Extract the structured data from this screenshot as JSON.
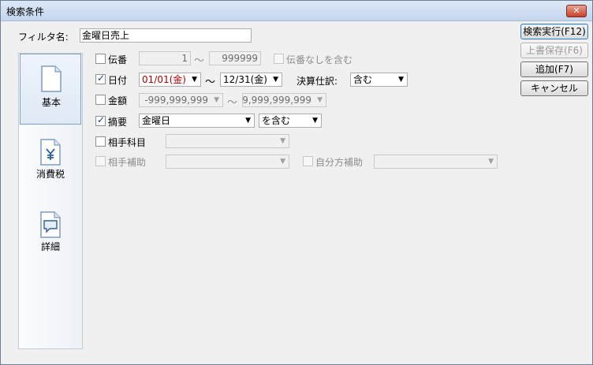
{
  "window": {
    "title": "検索条件",
    "close_glyph": "✕"
  },
  "filter": {
    "label": "フィルタ名:",
    "value": "金曜日売上"
  },
  "nav": {
    "items": [
      {
        "label": "基本",
        "icon": "page-icon",
        "selected": true
      },
      {
        "label": "消費税",
        "icon": "yen-page-icon",
        "selected": false
      },
      {
        "label": "詳細",
        "icon": "speech-bubble-page-icon",
        "selected": false
      }
    ]
  },
  "conditions": {
    "denban": {
      "label": "伝番",
      "checked": false,
      "from": "1",
      "to": "999999",
      "tilde": "～",
      "none_label": "伝番なしを含む",
      "none_checked": false
    },
    "date": {
      "label": "日付",
      "checked": true,
      "from": "01/01(金)",
      "to": "12/31(金)",
      "tilde": "～",
      "settlement_label": "決算仕訳:",
      "settlement_value": "含む"
    },
    "amount": {
      "label": "金額",
      "checked": false,
      "from": "-999,999,999",
      "to": "9,999,999,999",
      "tilde": "～"
    },
    "summary": {
      "label": "摘要",
      "checked": true,
      "value": "金曜日",
      "mode": "を含む"
    },
    "counter_account": {
      "label": "相手科目",
      "checked": false,
      "value": ""
    },
    "counter_sub": {
      "label": "相手補助",
      "checked": false,
      "value": "",
      "self_label": "自分方補助",
      "self_checked": false,
      "self_value": ""
    }
  },
  "buttons": {
    "search": "検索実行(F12)",
    "overwrite": "上書保存(F6)",
    "add": "追加(F7)",
    "cancel": "キャンセル"
  },
  "glyphs": {
    "check": "✓",
    "dropdown": "▼"
  },
  "colors": {
    "date_value": "#b00000",
    "title_bar": "#c4d6ee",
    "close_button": "#c8402a"
  }
}
